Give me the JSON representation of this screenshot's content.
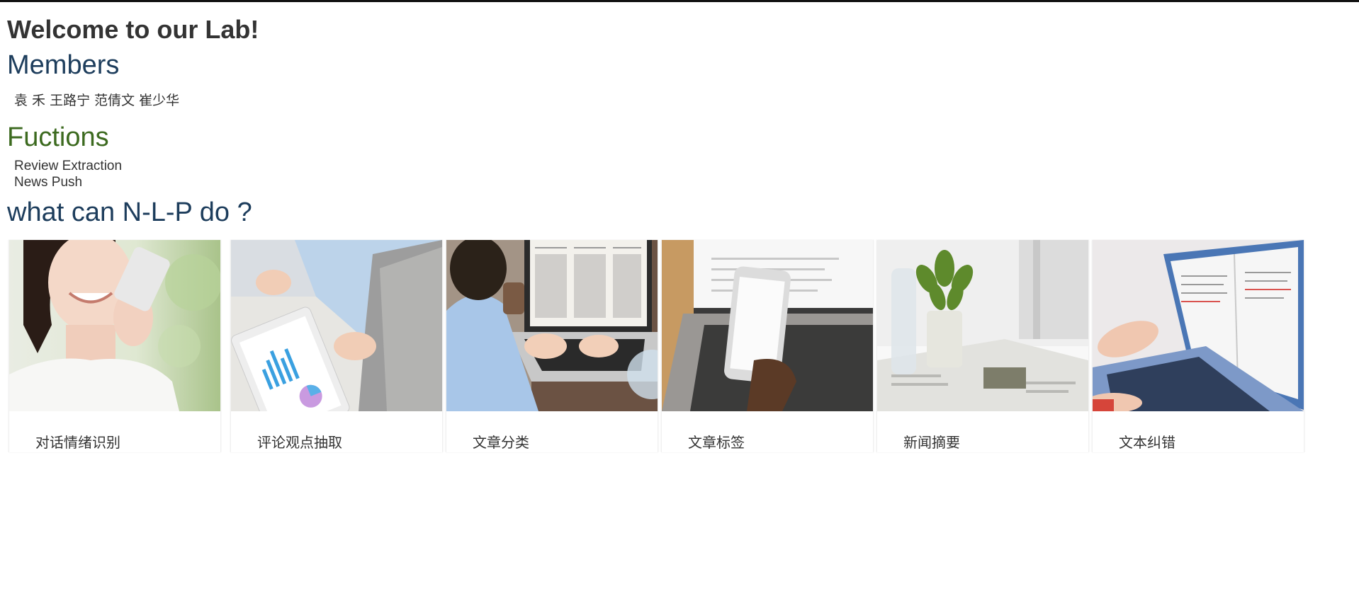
{
  "header": {
    "title": "Welcome to our Lab!"
  },
  "members": {
    "heading": "Members",
    "names": "袁 禾 王路宁 范倩文 崔少华"
  },
  "functions": {
    "heading": "Fuctions",
    "items": [
      "Review Extraction",
      "News Push"
    ]
  },
  "nlp": {
    "heading": "what can N-L-P do ?",
    "cards": [
      {
        "label": "对话情绪识别",
        "image": "woman-talking-on-phone"
      },
      {
        "label": "评论观点抽取",
        "image": "tablet-with-charts-meeting"
      },
      {
        "label": "文章分类",
        "image": "laptop-with-newspaper-columns"
      },
      {
        "label": "文章标签",
        "image": "hand-holding-smartphone-over-laptop"
      },
      {
        "label": "新闻摘要",
        "image": "newspaper-with-plant-and-bottle"
      },
      {
        "label": "文本纠错",
        "image": "typing-on-laptop-with-document"
      }
    ]
  },
  "colors": {
    "heading_blue": "#1d3d5c",
    "heading_green": "#3c6a1f",
    "text": "#333333"
  }
}
